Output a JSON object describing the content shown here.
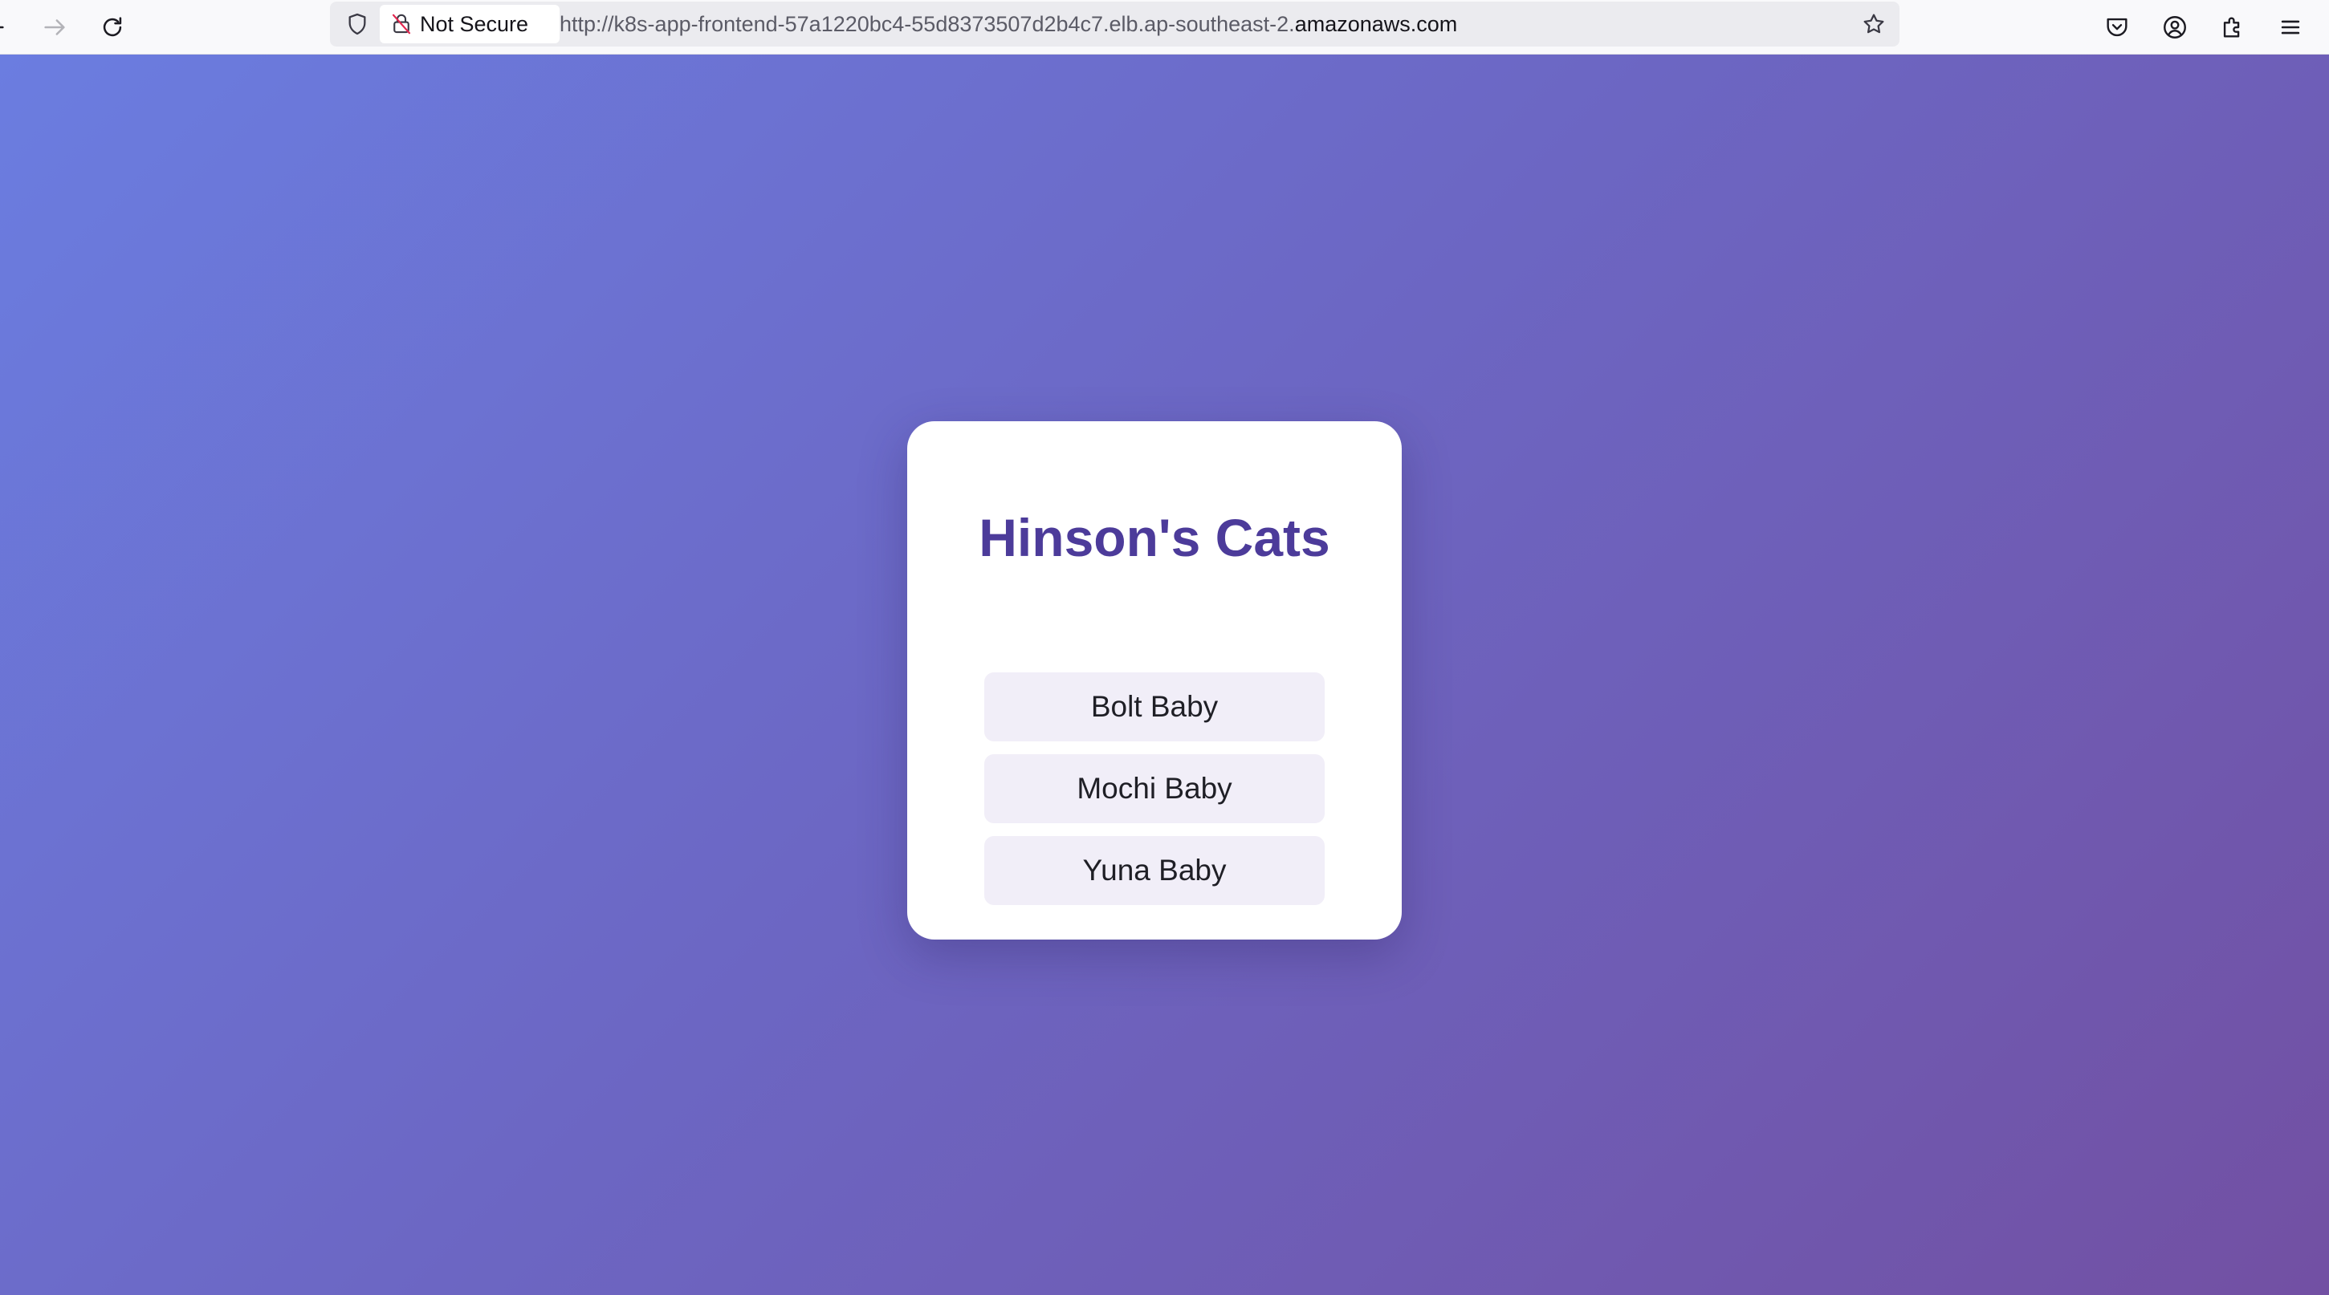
{
  "browser": {
    "nav": {
      "back_icon": "arrow-left-icon",
      "forward_icon": "arrow-right-icon",
      "reload_icon": "reload-icon"
    },
    "urlbar": {
      "security_label": "Not Secure",
      "url_prefix": "http://k8s-app-frontend-57a1220bc4-55d8373507d2b4c7.elb.ap-southeast-2.",
      "url_domain": "amazonaws.com"
    },
    "toolbar_icons": [
      "tracking-shield-icon",
      "bookmark-star-icon",
      "pocket-icon",
      "account-icon",
      "extensions-icon",
      "menu-icon"
    ]
  },
  "page": {
    "title": "Hinson's Cats",
    "cats": [
      {
        "label": "Bolt Baby"
      },
      {
        "label": "Mochi Baby"
      },
      {
        "label": "Yuna Baby"
      }
    ]
  },
  "colors": {
    "gradient_start": "#6b7de0",
    "gradient_end": "#7250a3",
    "title_color": "#4c3b9a",
    "button_bg": "#f1eef8"
  }
}
